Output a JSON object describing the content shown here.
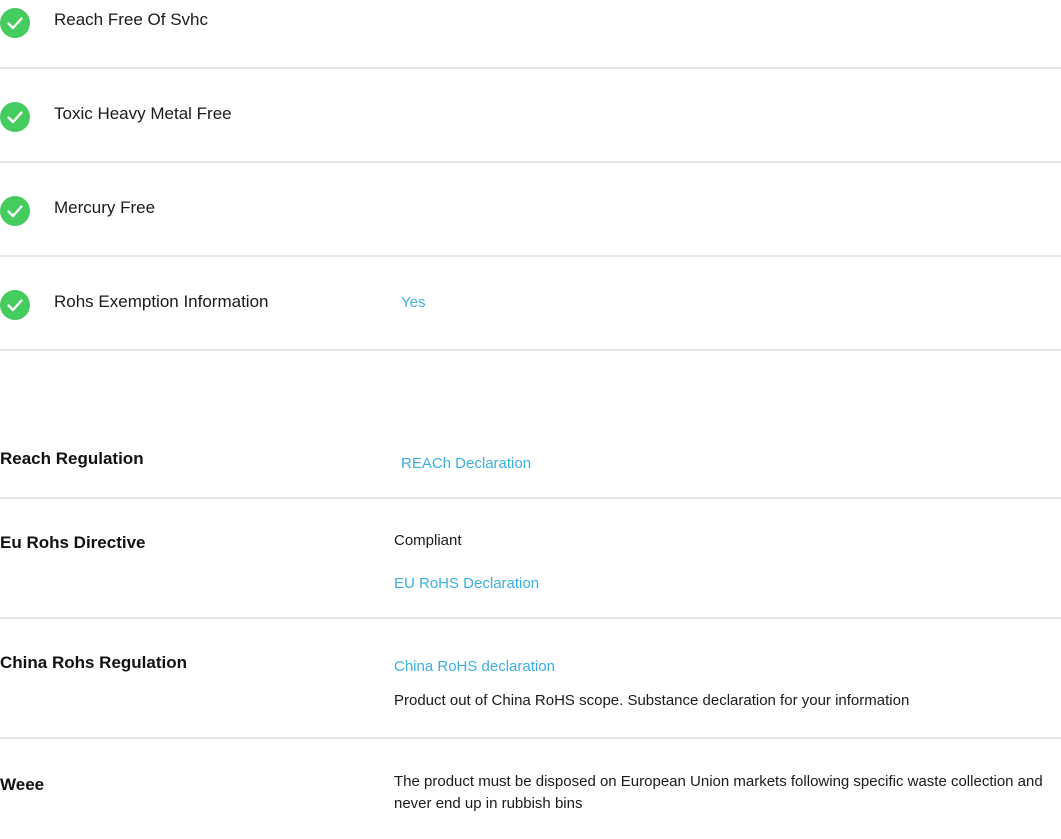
{
  "checks": [
    {
      "label": "Reach Free Of Svhc",
      "icon": "check-circle-icon"
    },
    {
      "label": "Toxic Heavy Metal Free",
      "icon": "check-circle-icon"
    },
    {
      "label": "Mercury Free",
      "icon": "check-circle-icon"
    },
    {
      "label": "Rohs Exemption Information",
      "icon": "check-circle-icon",
      "value": "Yes"
    }
  ],
  "regulations": {
    "reach": {
      "label": "Reach Regulation",
      "link": "REACh Declaration"
    },
    "eu_rohs": {
      "label": "Eu Rohs Directive",
      "status": "Compliant",
      "link": "EU RoHS Declaration"
    },
    "china_rohs": {
      "label": "China Rohs Regulation",
      "link": "China RoHS declaration",
      "note": "Product out of China RoHS scope. Substance declaration for your information"
    },
    "weee": {
      "label": "Weee",
      "text": "The product must be disposed on European Union markets following specific waste collection and never end up in rubbish bins"
    }
  },
  "colors": {
    "check_green": "#44cc5e",
    "link_blue": "#3ab0e2",
    "divider": "#e6e6e6"
  }
}
